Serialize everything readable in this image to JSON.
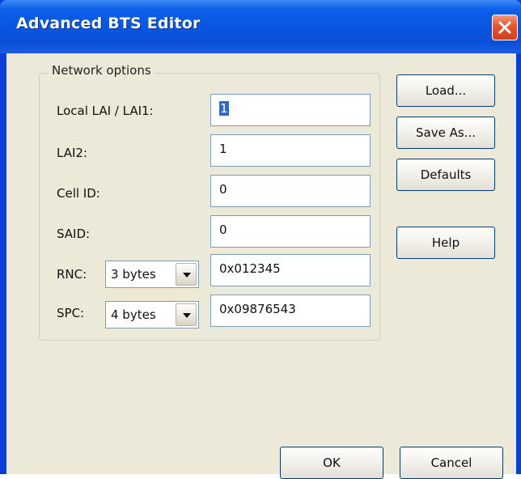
{
  "window": {
    "title": "Advanced BTS Editor",
    "close_icon": "close-icon"
  },
  "network_options": {
    "legend": "Network options",
    "local_lai_label": "Local LAI / LAI1:",
    "local_lai_value": "1",
    "lai2_label": "LAI2:",
    "lai2_value": "1",
    "cell_id_label": "Cell ID:",
    "cell_id_value": "0",
    "said_label": "SAID:",
    "said_value": "0",
    "rnc_label": "RNC:",
    "rnc_size": "3 bytes",
    "rnc_value": "0x012345",
    "spc_label": "SPC:",
    "spc_size": "4 bytes",
    "spc_value": "0x09876543"
  },
  "buttons": {
    "load": "Load...",
    "save_as": "Save As...",
    "defaults": "Defaults",
    "help": "Help",
    "ok": "OK",
    "cancel": "Cancel"
  },
  "colors": {
    "title_bar": "#0a55e0",
    "dialog_face": "#ece9d8",
    "close_button": "#e5542c",
    "selection": "#316ac5"
  }
}
